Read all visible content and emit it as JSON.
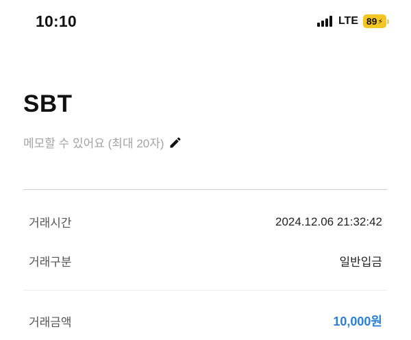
{
  "status_bar": {
    "time": "10:10",
    "network": "LTE",
    "battery": "89",
    "icons": [
      "signal-bars-icon",
      "battery-charging-icon"
    ]
  },
  "header": {
    "title": "SBT"
  },
  "memo": {
    "placeholder": "메모할 수 있어요 (최대 20자)",
    "icon": "pencil-icon"
  },
  "details": {
    "time_label": "거래시간",
    "time_value": "2024.12.06 21:32:42",
    "type_label": "거래구분",
    "type_value": "일반입금",
    "amount_label": "거래금액",
    "amount_value": "10,000원"
  },
  "colors": {
    "amount": "#2b7fd6",
    "battery": "#f3c623",
    "placeholder": "#a3a3a3"
  }
}
